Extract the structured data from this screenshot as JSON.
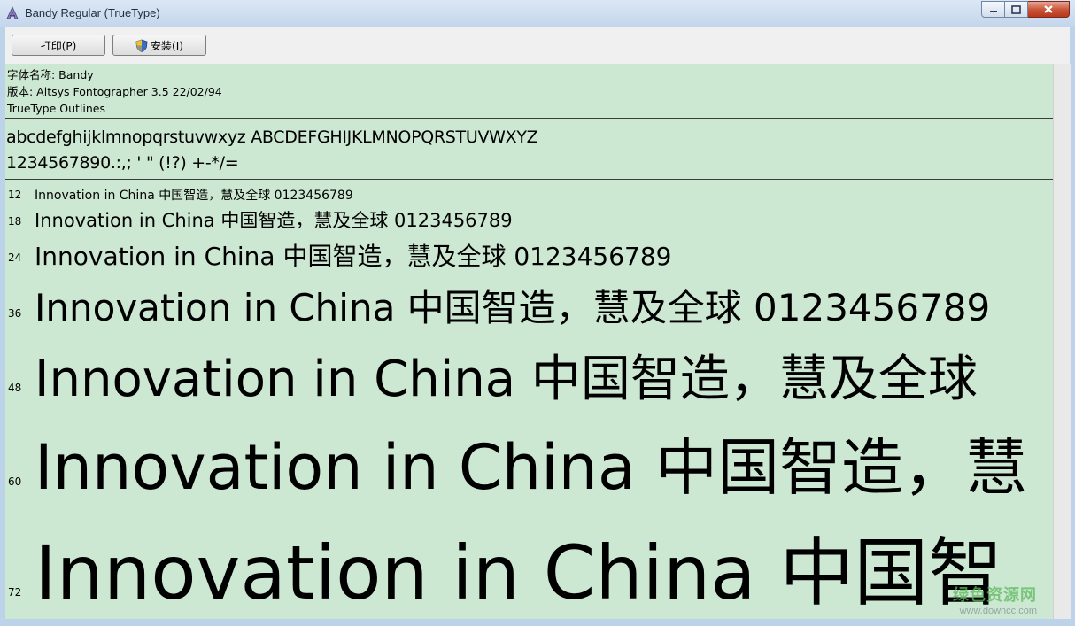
{
  "window": {
    "title": "Bandy Regular (TrueType)"
  },
  "toolbar": {
    "print_label": "打印(P)",
    "install_label": "安装(I)"
  },
  "font_info": {
    "name_line": "字体名称: Bandy",
    "version_line": "版本: Altsys Fontographer 3.5  22/02/94",
    "outline_line": "TrueType Outlines"
  },
  "charset": {
    "letters": "abcdefghijklmnopqrstuvwxyz ABCDEFGHIJKLMNOPQRSTUVWXYZ",
    "digits": "1234567890.:,; ' \" (!?) +-*/="
  },
  "samples": [
    {
      "size": "12",
      "text": "Innovation in China 中国智造，慧及全球 0123456789"
    },
    {
      "size": "18",
      "text": "Innovation in China 中国智造，慧及全球 0123456789"
    },
    {
      "size": "24",
      "text": "Innovation in China 中国智造，慧及全球 0123456789"
    },
    {
      "size": "36",
      "text": "Innovation in China 中国智造，慧及全球 0123456789"
    },
    {
      "size": "48",
      "text": "Innovation in China 中国智造，慧及全球"
    },
    {
      "size": "60",
      "text": "Innovation in China 中国智造，慧"
    },
    {
      "size": "72",
      "text": "Innovation in China 中国智"
    }
  ],
  "watermark": {
    "line1": "绿色资源网",
    "line2": "www.downcc.com"
  },
  "colors": {
    "content_bg": "#cde8d2",
    "close_button": "#c75236"
  }
}
